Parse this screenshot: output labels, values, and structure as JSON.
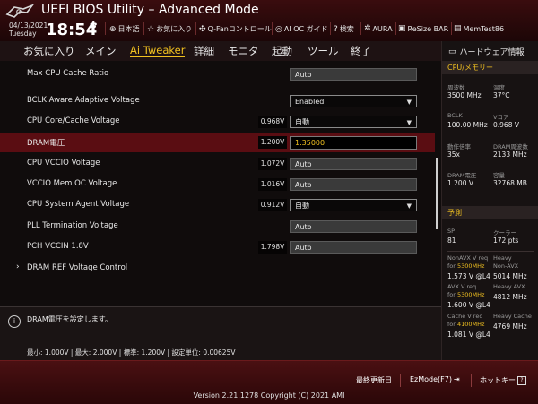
{
  "header": {
    "title": "UEFI BIOS Utility – Advanced Mode",
    "date": "04/13/2021",
    "day": "Tuesday",
    "time": "18:54",
    "tools": [
      {
        "icon": "globe-icon",
        "glyph": "⊕",
        "label": "日本語"
      },
      {
        "icon": "star-icon",
        "glyph": "☆",
        "label": "お気に入り"
      },
      {
        "icon": "fan-icon",
        "glyph": "✣",
        "label": "Q-Fanコントロール"
      },
      {
        "icon": "ai-icon",
        "glyph": "◎",
        "label": "AI OC ガイド"
      },
      {
        "icon": "help-icon",
        "glyph": "?",
        "label": "検索"
      },
      {
        "icon": "aura-icon",
        "glyph": "✲",
        "label": "AURA"
      },
      {
        "icon": "resize-bar-icon",
        "glyph": "▣",
        "label": "ReSize BAR"
      },
      {
        "icon": "memtest-icon",
        "glyph": "▤",
        "label": "MemTest86"
      }
    ]
  },
  "menu": [
    "お気に入り",
    "メイン",
    "Ai Tweaker",
    "詳細",
    "モニタ",
    "起動",
    "ツール",
    "終了"
  ],
  "menu_active": "Ai Tweaker",
  "settings": {
    "max_cpu_cache_ratio": {
      "label": "Max CPU Cache Ratio",
      "value": "Auto"
    },
    "bclk_aware": {
      "label": "BCLK Aware Adaptive Voltage",
      "value": "Enabled"
    },
    "cpu_core_cache_voltage": {
      "label": "CPU Core/Cache Voltage",
      "current": "0.968V",
      "value": "自動"
    },
    "dram_voltage": {
      "label": "DRAM電圧",
      "current": "1.200V",
      "value": "1.35000"
    },
    "cpu_vccio": {
      "label": "CPU VCCIO Voltage",
      "current": "1.072V",
      "value": "Auto"
    },
    "vccio_mem_oc": {
      "label": "VCCIO Mem OC Voltage",
      "current": "1.016V",
      "value": "Auto"
    },
    "cpu_system_agent": {
      "label": "CPU System Agent Voltage",
      "current": "0.912V",
      "value": "自動"
    },
    "pll_termination": {
      "label": "PLL Termination Voltage",
      "value": "Auto"
    },
    "pch_vccin": {
      "label": "PCH VCCIN 1.8V",
      "current": "1.798V",
      "value": "Auto"
    },
    "dram_ref": {
      "label": "DRAM REF Voltage Control"
    }
  },
  "info": {
    "message": "DRAM電圧を設定します。",
    "specs": "最小: 1.000V  |  最大: 2.000V  |  標準: 1.200V  |  設定単位: 0.00625V"
  },
  "hw": {
    "title": "ハードウェア情報",
    "cpu_section": "CPU/メモリー",
    "freq_label": "周波数",
    "freq": "3500 MHz",
    "temp_label": "温度",
    "temp": "37°C",
    "bclk_label": "BCLK",
    "bclk": "100.00 MHz",
    "vcore_label": "Vコア",
    "vcore": "0.968 V",
    "ratio_label": "動作倍率",
    "ratio": "35x",
    "dram_freq_label": "DRAM周波数",
    "dram_freq": "2133 MHz",
    "dram_v_label": "DRAM電圧",
    "dram_v": "1.200 V",
    "capacity_label": "容量",
    "capacity": "32768 MB",
    "predict_section": "予測",
    "sp_label": "SP",
    "sp": "81",
    "cooler_label": "クーラー",
    "cooler": "172 pts",
    "nonavx_l1": "NonAVX V req",
    "nonavx_for": "for ",
    "nonavx_mhz": "5300MHz",
    "nonavx_v": "1.573 V @L4",
    "heavy_nonavx_l1": "Heavy",
    "heavy_nonavx_l2": "Non-AVX",
    "heavy_nonavx": "5014 MHz",
    "avx_l1": "AVX V req",
    "avx_for": "for ",
    "avx_mhz": "5300MHz",
    "avx_v": "1.600 V @L4",
    "heavy_avx_l1": "Heavy AVX",
    "heavy_avx": "4812 MHz",
    "cache_l1": "Cache V req",
    "cache_for": "for ",
    "cache_mhz": "4100MHz",
    "cache_v": "1.081 V @L4",
    "heavy_cache_l1": "Heavy Cache",
    "heavy_cache": "4769 MHz"
  },
  "footer": {
    "last_modified": "最終更新日",
    "ezmode": "EzMode(F7)",
    "hotkey": "ホットキー",
    "hotkey_key": "?",
    "version": "Version 2.21.1278 Copyright (C) 2021 AMI"
  },
  "colors": {
    "accent": "#f0c020",
    "selected_row": "#5a0d12",
    "header": "#3a0c0e"
  }
}
